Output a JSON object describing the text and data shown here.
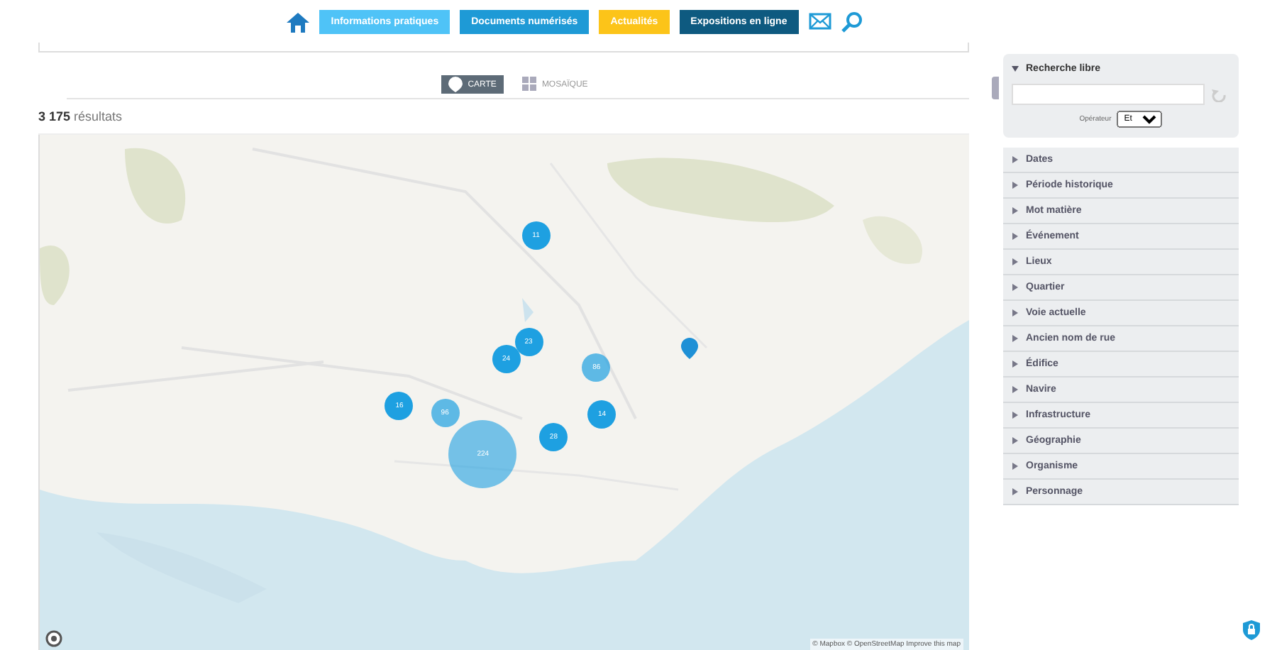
{
  "nav": {
    "items": [
      {
        "label": "Informations pratiques",
        "color": "#4fc3f7"
      },
      {
        "label": "Documents numérisés",
        "color": "#1e9ad6"
      },
      {
        "label": "Actualités",
        "color": "#fcc419"
      },
      {
        "label": "Expositions en ligne",
        "color": "#0e5a80"
      }
    ]
  },
  "view_toggle": [
    {
      "label": "CARTE",
      "selected": true
    },
    {
      "label": "MOSAÏQUE",
      "selected": false
    }
  ],
  "results": {
    "count": "3 175",
    "label": "résultats"
  },
  "map": {
    "clusters": [
      "11",
      "23",
      "24",
      "86",
      "16",
      "96",
      "14",
      "28",
      "224"
    ],
    "attribution": "© Mapbox © OpenStreetMap Improve this map"
  },
  "sidebar": {
    "search": {
      "title": "Recherche libre",
      "expanded": true,
      "operator_label": "Opérateur",
      "operator_value": "Et"
    },
    "facets": [
      {
        "label": "Dates",
        "expanded": false
      },
      {
        "label": "Période historique",
        "expanded": false
      },
      {
        "label": "Mot matière",
        "expanded": false
      },
      {
        "label": "Événement",
        "expanded": false
      },
      {
        "label": "Lieux",
        "expanded": false
      },
      {
        "label": "Quartier",
        "expanded": false
      },
      {
        "label": "Voie actuelle",
        "expanded": false
      },
      {
        "label": "Ancien nom de rue",
        "expanded": false
      },
      {
        "label": "Édifice",
        "expanded": false
      },
      {
        "label": "Navire",
        "expanded": false
      },
      {
        "label": "Infrastructure",
        "expanded": false
      },
      {
        "label": "Géographie",
        "expanded": false
      },
      {
        "label": "Organisme",
        "expanded": false
      },
      {
        "label": "Personnage",
        "expanded": false
      }
    ]
  }
}
